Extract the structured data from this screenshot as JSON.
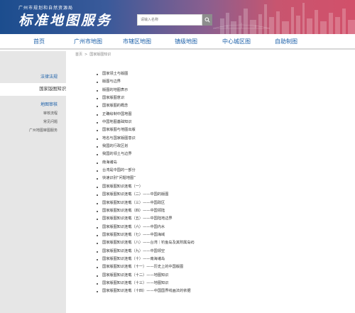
{
  "header": {
    "org_name": "广州市规划和自然资源局",
    "site_title": "标准地图服务",
    "search_placeholder": "请输入名称"
  },
  "nav": {
    "items": [
      {
        "label": "首页"
      },
      {
        "label": "广州市地图"
      },
      {
        "label": "市辖区地图"
      },
      {
        "label": "镇级地图"
      },
      {
        "label": "中心城区图"
      },
      {
        "label": "自助制图"
      }
    ]
  },
  "sidebar": {
    "group1": "法律法规",
    "active_item": "国家版图知识",
    "group2": "地图审核",
    "sub_items": [
      {
        "label": "审核流程"
      },
      {
        "label": "常见问题"
      },
      {
        "label": "广州地图审图服务"
      }
    ]
  },
  "breadcrumb": {
    "home": "首页",
    "separator": ">",
    "current": "国家版图知识"
  },
  "article_list": [
    "国家领土与版图",
    "版图与边界",
    "版图的地图表示",
    "国家版图意识",
    "国家版图的概念",
    "正确绘制中国地图",
    "中国地图基础知识",
    "国家版图与地图出版",
    "地名与国家版图意识",
    "我国的行政区划",
    "我国的领土与边界",
    "南海诸岛",
    "台湾是中国的一部分",
    "快速识别“问题地图”",
    "国家版图知识连载（一）",
    "国家版图知识连载（二）——中国的版图",
    "国家版图知识连载（三）——中国政区",
    "国家版图知识连载（四）——中国领陆",
    "国家版图知识连载（五）——中国陆地边界",
    "国家版图知识连载（六）——中国内水",
    "国家版图知识连载（七）——中国海域",
    "国家版图知识连载（八）——台湾｜钓鱼岛及其附属岛屿",
    "国家版图知识连载（九）——中国领空",
    "国家版图知识连载（十）——南海诸岛",
    "国家版图知识连载（十一）——历史上的中国版图",
    "国家版图知识连载（十二）——地图知识",
    "国家版图知识连载（十三）——地图知识",
    "国家版图知识连载（十四）——中国国界线画法的依据"
  ],
  "colors": {
    "banner_left": "#1c4d8e",
    "banner_right": "#d2506a",
    "nav_text": "#1b5fa8",
    "sidebar_bg": "#e6e6e6"
  },
  "icons": {
    "search": "search-icon"
  }
}
